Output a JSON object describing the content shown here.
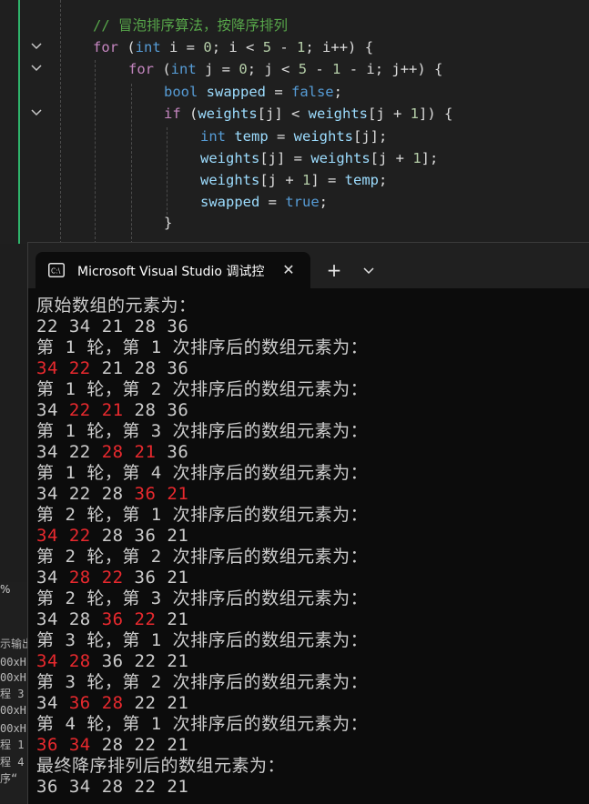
{
  "editor": {
    "lines": [
      {
        "comment": "// 冒泡排序算法，按降序排列"
      },
      {
        "kw": "for",
        "open": " (",
        "type": "int",
        "rest1": " i = ",
        "n0": "0",
        "rest2": "; i < ",
        "n5": "5",
        "minus": " - ",
        "n1": "1",
        "rest3": "; i++) {"
      },
      {
        "kw": "for",
        "open": " (",
        "type": "int",
        "rest1": " j = ",
        "n0": "0",
        "rest2": "; j < ",
        "n5": "5",
        "minus": " - ",
        "n1": "1",
        "rest3": " - i; j++) {"
      },
      {
        "type": "bool",
        "var": " swapped",
        "eq": " = ",
        "val": "false",
        "end": ";"
      },
      {
        "kw": "if",
        "open": " (",
        "v1": "weights",
        "b1": "[j] < ",
        "v2": "weights",
        "b2": "[j + ",
        "n1": "1",
        "b3": "]) {"
      },
      {
        "type": "int",
        "var": " temp",
        "eq": " = ",
        "v1": "weights",
        "end": "[j];"
      },
      {
        "v1": "weights",
        "mid": "[j] = ",
        "v2": "weights",
        "b2": "[j + ",
        "n1": "1",
        "end": "];"
      },
      {
        "v1": "weights",
        "b1": "[j + ",
        "n1": "1",
        "mid": "] = ",
        "v2": "temp",
        "end": ";"
      },
      {
        "var": "swapped",
        "eq": " = ",
        "val": "true",
        "end": ";"
      },
      {
        "brace": "}"
      }
    ]
  },
  "ghost": {
    "percent": "%",
    "lines": [
      "示输出",
      "00xH",
      "00xH",
      "程 3",
      "00xH",
      "00xH",
      "程 1",
      "程 4",
      "序“"
    ]
  },
  "terminal": {
    "tab_title": "Microsoft Visual Studio 调试控",
    "close_glyph": "✕",
    "add_glyph": "+",
    "colors": {
      "background": "#0c0c0c",
      "text": "#cccccc",
      "highlight": "#e8292e"
    },
    "lines": [
      {
        "text": "原始数组的元素为："
      },
      {
        "nums": [
          "22",
          "34",
          "21",
          "28",
          "36"
        ],
        "hl": []
      },
      {
        "text": "第 1 轮，第 1 次排序后的数组元素为："
      },
      {
        "nums": [
          "34",
          "22",
          "21",
          "28",
          "36"
        ],
        "hl": [
          0,
          1
        ]
      },
      {
        "text": "第 1 轮，第 2 次排序后的数组元素为："
      },
      {
        "nums": [
          "34",
          "22",
          "21",
          "28",
          "36"
        ],
        "hl": [
          1,
          2
        ]
      },
      {
        "text": "第 1 轮，第 3 次排序后的数组元素为："
      },
      {
        "nums": [
          "34",
          "22",
          "28",
          "21",
          "36"
        ],
        "hl": [
          2,
          3
        ]
      },
      {
        "text": "第 1 轮，第 4 次排序后的数组元素为："
      },
      {
        "nums": [
          "34",
          "22",
          "28",
          "36",
          "21"
        ],
        "hl": [
          3,
          4
        ]
      },
      {
        "text": "第 2 轮，第 1 次排序后的数组元素为："
      },
      {
        "nums": [
          "34",
          "22",
          "28",
          "36",
          "21"
        ],
        "hl": [
          0,
          1
        ]
      },
      {
        "text": "第 2 轮，第 2 次排序后的数组元素为："
      },
      {
        "nums": [
          "34",
          "28",
          "22",
          "36",
          "21"
        ],
        "hl": [
          1,
          2
        ]
      },
      {
        "text": "第 2 轮，第 3 次排序后的数组元素为："
      },
      {
        "nums": [
          "34",
          "28",
          "36",
          "22",
          "21"
        ],
        "hl": [
          2,
          3
        ]
      },
      {
        "text": "第 3 轮，第 1 次排序后的数组元素为："
      },
      {
        "nums": [
          "34",
          "28",
          "36",
          "22",
          "21"
        ],
        "hl": [
          0,
          1
        ]
      },
      {
        "text": "第 3 轮，第 2 次排序后的数组元素为："
      },
      {
        "nums": [
          "34",
          "36",
          "28",
          "22",
          "21"
        ],
        "hl": [
          1,
          2
        ]
      },
      {
        "text": "第 4 轮，第 1 次排序后的数组元素为："
      },
      {
        "nums": [
          "36",
          "34",
          "28",
          "22",
          "21"
        ],
        "hl": [
          0,
          1
        ]
      },
      {
        "text": "最终降序排列后的数组元素为："
      },
      {
        "nums": [
          "36",
          "34",
          "28",
          "22",
          "21"
        ],
        "hl": []
      }
    ]
  }
}
